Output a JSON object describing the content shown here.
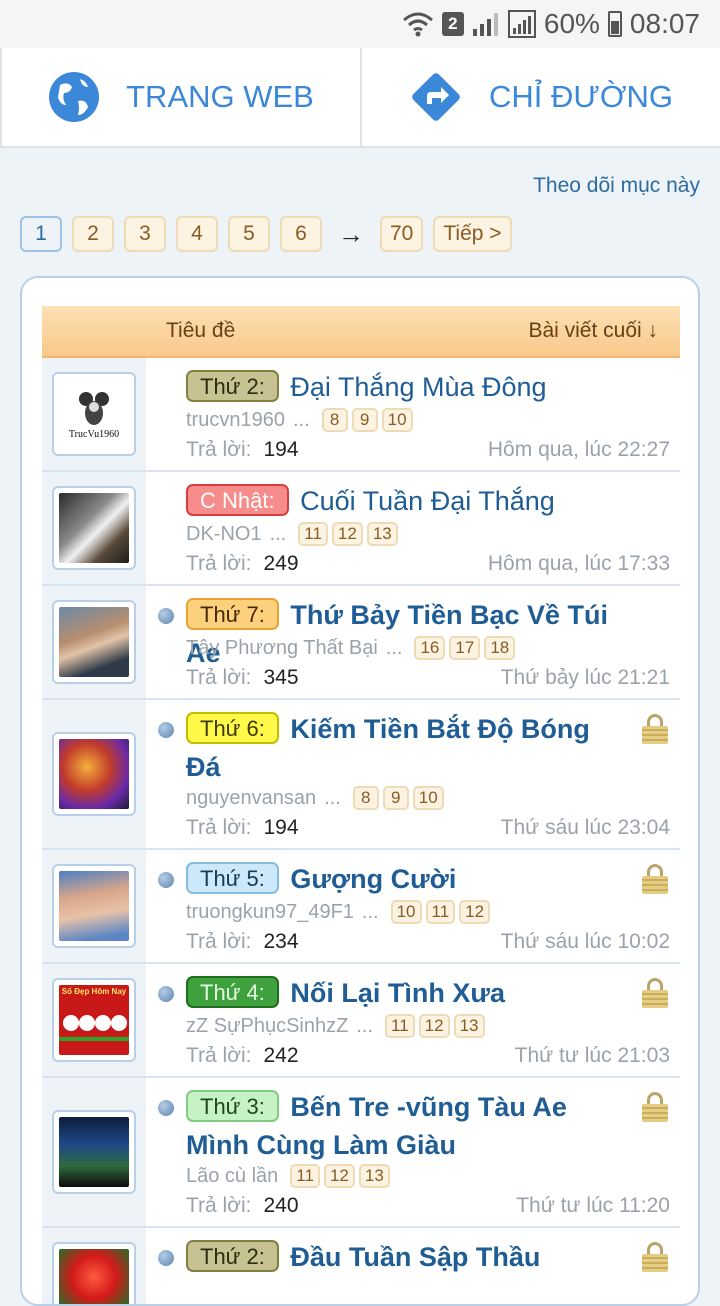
{
  "status_bar": {
    "sim_badge": "2",
    "battery": "60%",
    "time": "08:07"
  },
  "actions": {
    "website": "TRANG WEB",
    "directions": "CHỈ ĐƯỜNG"
  },
  "watch_link": "Theo dõi mục này",
  "pager": {
    "pages": [
      "1",
      "2",
      "3",
      "4",
      "5",
      "6"
    ],
    "arrow": "→",
    "last": "70",
    "next": "Tiếp >"
  },
  "table": {
    "col_title": "Tiêu đề",
    "col_last": "Bài viết cuối ↓"
  },
  "threads": [
    {
      "prefix": "Thứ 2:",
      "title": "Đại Thắng Mùa Đông",
      "author": "trucvn1960",
      "pages": [
        "8",
        "9",
        "10"
      ],
      "replies_label": "Trả lời:",
      "replies": "194",
      "date": "Hôm qua, lúc 22:27",
      "avatar_text": "TrucVu1960"
    },
    {
      "prefix": "C Nhật:",
      "title": "Cuối Tuần Đại Thắng",
      "author": "DK-NO1",
      "pages": [
        "11",
        "12",
        "13"
      ],
      "replies_label": "Trả lời:",
      "replies": "249",
      "date": "Hôm qua, lúc 17:33"
    },
    {
      "prefix": "Thứ 7:",
      "title": "Thứ Bảy Tiền Bạc Về Túi Ae",
      "author": "Tây Phương Thất Bại",
      "pages": [
        "16",
        "17",
        "18"
      ],
      "replies_label": "Trả lời:",
      "replies": "345",
      "date": "Thứ bảy lúc 21:21"
    },
    {
      "prefix": "Thứ 6:",
      "title": "Kiếm Tiền Bắt Độ Bóng",
      "title2": "Đá",
      "author": "nguyenvansan",
      "pages": [
        "8",
        "9",
        "10"
      ],
      "replies_label": "Trả lời:",
      "replies": "194",
      "date": "Thứ sáu lúc 23:04"
    },
    {
      "prefix": "Thứ 5:",
      "title": "Gượng Cười",
      "author": "truongkun97_49F1",
      "pages": [
        "10",
        "11",
        "12"
      ],
      "replies_label": "Trả lời:",
      "replies": "234",
      "date": "Thứ sáu lúc 10:02"
    },
    {
      "prefix": "Thứ 4:",
      "title": "Nối Lại Tình Xưa",
      "author": "zZ SựPhụcSinhzZ",
      "pages": [
        "11",
        "12",
        "13"
      ],
      "replies_label": "Trả lời:",
      "replies": "242",
      "date": "Thứ tư lúc 21:03",
      "avatar_text": "Số Đẹp Hôm Nay"
    },
    {
      "prefix": "Thứ 3:",
      "title": "Bến Tre -vũng Tàu Ae",
      "title2": "Mình Cùng Làm Giàu",
      "author": "Lão cù lần",
      "pages": [
        "11",
        "12",
        "13"
      ],
      "replies_label": "Trả lời:",
      "replies": "240",
      "date": "Thứ tư lúc 11:20"
    },
    {
      "prefix": "Thứ 2:",
      "title": "Đầu Tuần Sập Thầu"
    }
  ],
  "colors": {
    "accent": "#3c88d8",
    "link": "#1f5d94",
    "header_bg": "#f8c98a"
  }
}
